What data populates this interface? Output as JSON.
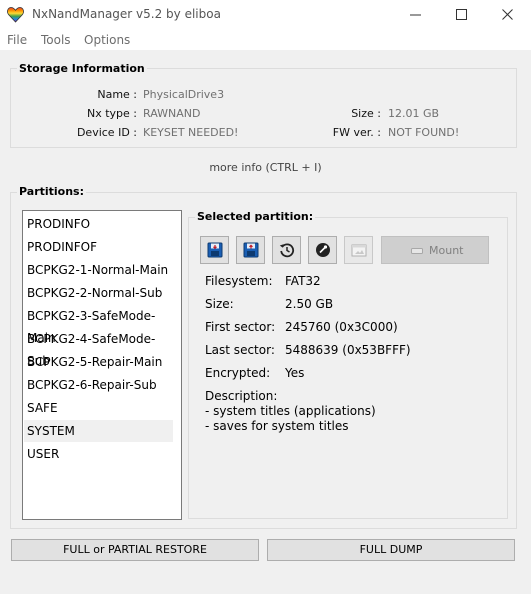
{
  "window": {
    "title": "NxNandManager v5.2 by eliboa",
    "icon": "rainbow-heart-icon",
    "controls": [
      "minimize-icon",
      "maximize-icon",
      "close-icon"
    ]
  },
  "menu": {
    "file": "File",
    "tools": "Tools",
    "options": "Options"
  },
  "storage": {
    "title": "Storage Information",
    "name_label": "Name :",
    "name_value": "PhysicalDrive3",
    "nxtype_label": "Nx type :",
    "nxtype_value": "RAWNAND",
    "deviceid_label": "Device ID :",
    "deviceid_value": "KEYSET NEEDED!",
    "size_label": "Size :",
    "size_value": "12.01 GB",
    "fwver_label": "FW ver. :",
    "fwver_value": "NOT FOUND!",
    "more_info": "more info (CTRL + I)"
  },
  "partitions": {
    "title": "Partitions:",
    "items": [
      "PRODINFO",
      "PRODINFOF",
      "BCPKG2-1-Normal-Main",
      "BCPKG2-2-Normal-Sub",
      "BCPKG2-3-SafeMode-Main",
      "BCPKG2-4-SafeMode-Sub",
      "BCPKG2-5-Repair-Main",
      "BCPKG2-6-Repair-Sub",
      "SAFE",
      "SYSTEM",
      "USER"
    ],
    "selected": "SYSTEM"
  },
  "selected_partition": {
    "title": "Selected partition:",
    "toolbar_icons": [
      "dump-icon",
      "restore-icon",
      "history-icon",
      "encrypt-icon",
      "explore-icon"
    ],
    "mount_label": "Mount",
    "filesystem_label": "Filesystem:",
    "filesystem_value": "FAT32",
    "size_label": "Size:",
    "size_value": "2.50 GB",
    "first_sector_label": "First sector:",
    "first_sector_value": "245760 (0x3C000)",
    "last_sector_label": "Last sector:",
    "last_sector_value": "5488639 (0x53BFFF)",
    "encrypted_label": "Encrypted:",
    "encrypted_value": "Yes",
    "description_label": "Description:",
    "description_line1": "- system titles (applications)",
    "description_line2": "- saves for system titles"
  },
  "actions": {
    "restore": "FULL or PARTIAL RESTORE",
    "dump": "FULL DUMP"
  }
}
